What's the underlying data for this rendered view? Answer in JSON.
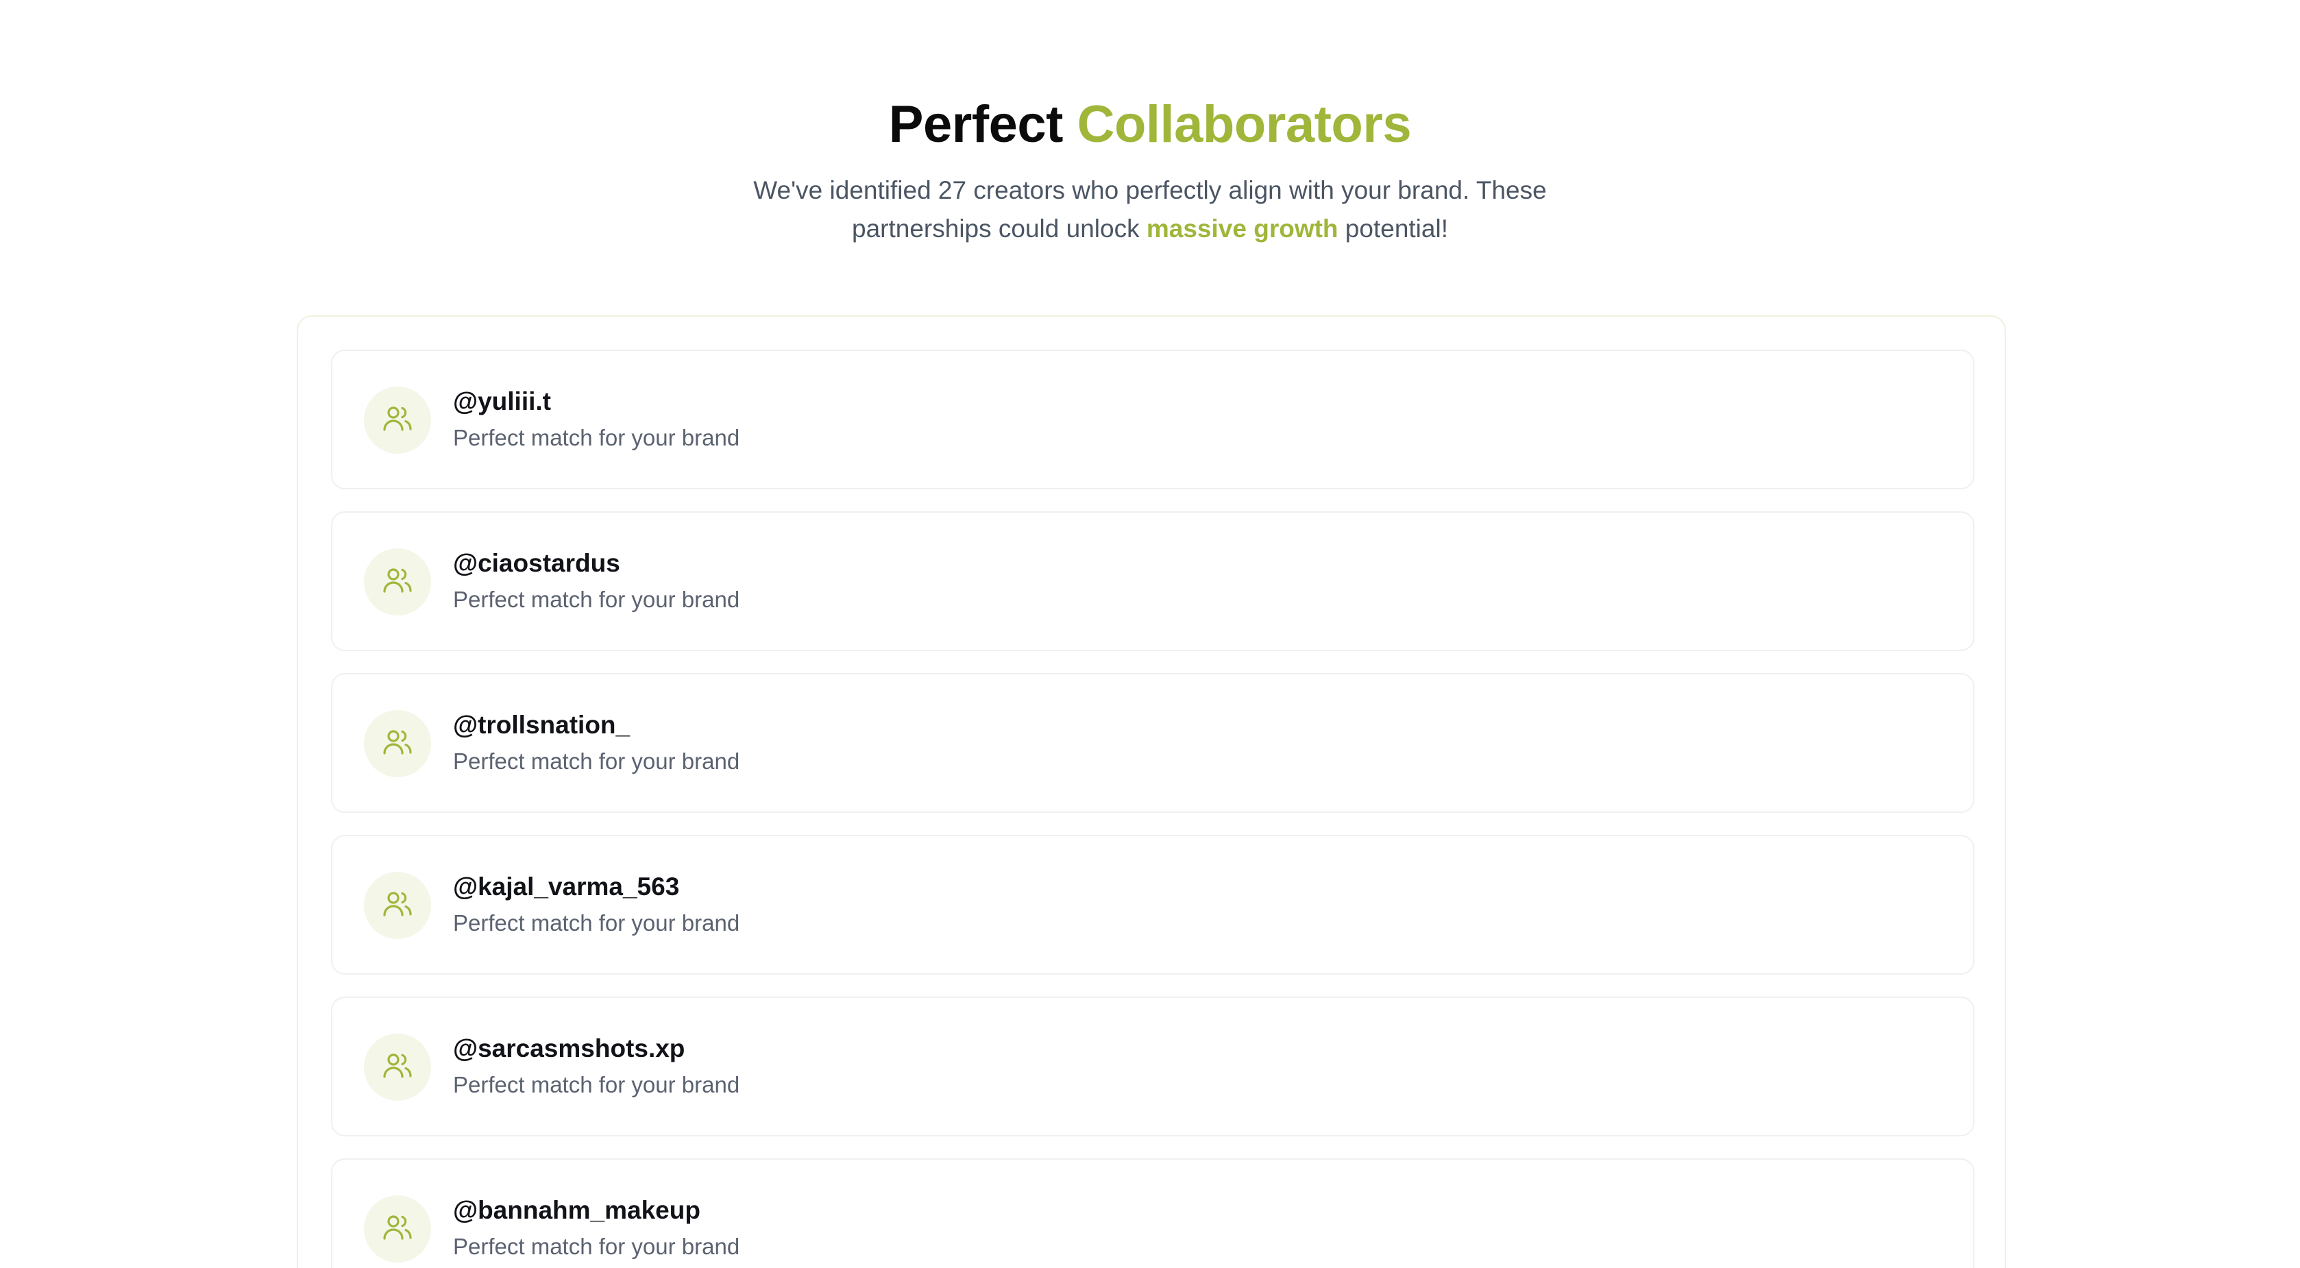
{
  "header": {
    "title_main": "Perfect",
    "title_accent": "Collaborators",
    "subtitle_pre": "We've identified 27 creators who perfectly align with your brand. These partnerships could unlock ",
    "subtitle_highlight": "massive growth",
    "subtitle_post": " potential!"
  },
  "creators": [
    {
      "handle": "@yuliii.t",
      "description": "Perfect match for your brand",
      "icon": "users-icon"
    },
    {
      "handle": "@ciaostardus",
      "description": "Perfect match for your brand",
      "icon": "users-icon"
    },
    {
      "handle": "@trollsnation_",
      "description": "Perfect match for your brand",
      "icon": "users-icon"
    },
    {
      "handle": "@kajal_varma_563",
      "description": "Perfect match for your brand",
      "icon": "users-icon"
    },
    {
      "handle": "@sarcasmshots.xp",
      "description": "Perfect match for your brand",
      "icon": "users-icon"
    },
    {
      "handle": "@bannahm_makeup",
      "description": "Perfect match for your brand",
      "icon": "users-icon"
    }
  ],
  "colors": {
    "accent": "#9fb63a",
    "avatar_bg": "#f4f6e8",
    "text_primary": "#111318",
    "text_secondary": "#5b6270"
  }
}
